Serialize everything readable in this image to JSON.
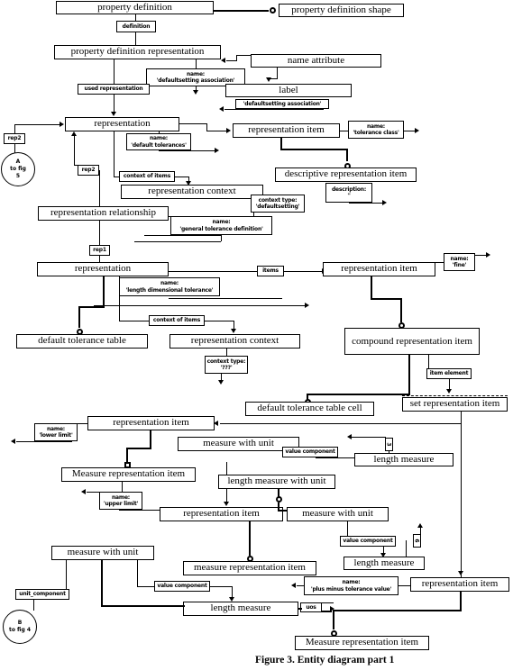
{
  "figure": {
    "caption": "Figure 3.  Entity diagram part 1"
  },
  "entities": [
    {
      "id": "property_definition",
      "label": "property definition"
    },
    {
      "id": "property_definition_shape",
      "label": "property definition shape"
    },
    {
      "id": "property_definition_representation",
      "label": "property definition representation"
    },
    {
      "id": "name_attribute",
      "label": "name attribute"
    },
    {
      "id": "label",
      "label": "label"
    },
    {
      "id": "representation_1",
      "label": "representation"
    },
    {
      "id": "representation_item_1",
      "label": "representation item"
    },
    {
      "id": "descriptive_representation_item",
      "label": "descriptive representation item"
    },
    {
      "id": "representation_context_1",
      "label": "representation context"
    },
    {
      "id": "representation_relationship",
      "label": "representation relationship"
    },
    {
      "id": "representation_2",
      "label": "representation"
    },
    {
      "id": "representation_item_2",
      "label": "representation item"
    },
    {
      "id": "default_tolerance_table",
      "label": "default tolerance table"
    },
    {
      "id": "representation_context_2",
      "label": "representation context"
    },
    {
      "id": "compound_representation_item",
      "label": "compound representation item"
    },
    {
      "id": "default_tolerance_table_cell",
      "label": "default tolerance table cell"
    },
    {
      "id": "set_representation_item",
      "label": "set representation item"
    },
    {
      "id": "representation_item_3",
      "label": "representation item"
    },
    {
      "id": "measure_with_unit_1",
      "label": "measure with unit"
    },
    {
      "id": "length_measure_1",
      "label": "length measure"
    },
    {
      "id": "measure_representation_item_1",
      "label": "Measure representation item"
    },
    {
      "id": "length_measure_with_unit",
      "label": "length measure with unit"
    },
    {
      "id": "representation_item_4",
      "label": "representation item"
    },
    {
      "id": "measure_with_unit_2",
      "label": "measure with unit"
    },
    {
      "id": "length_measure_2",
      "label": "length measure"
    },
    {
      "id": "measure_with_unit_3",
      "label": "measure with unit"
    },
    {
      "id": "measure_representation_item_2",
      "label": "measure representation item"
    },
    {
      "id": "length_measure_3",
      "label": "length measure"
    },
    {
      "id": "representation_item_5",
      "label": "representation item"
    },
    {
      "id": "measure_representation_item_3",
      "label": "Measure representation item"
    }
  ],
  "attributes": [
    {
      "id": "definition",
      "label": "definition"
    },
    {
      "id": "name_defsetting_assoc",
      "line1": "name:",
      "line2": "'defaultsetting association'"
    },
    {
      "id": "used_representation",
      "label": "used representation"
    },
    {
      "id": "defsetting_assoc_val",
      "label": "'defaultsetting association'"
    },
    {
      "id": "rep2_a",
      "label": "rep2"
    },
    {
      "id": "rep2_b",
      "label": "rep2"
    },
    {
      "id": "name_default_tolerances",
      "line1": "name:",
      "line2": "'default tolerances'"
    },
    {
      "id": "name_tolerance_class",
      "line1": "name:",
      "line2": "'tolerance class'"
    },
    {
      "id": "context_of_items_1",
      "label": "context of items"
    },
    {
      "id": "description_empty",
      "line1": "description:",
      "line2": "''"
    },
    {
      "id": "context_type_defsetting",
      "line1": "context type:",
      "line2": "'defaultsetting'"
    },
    {
      "id": "name_general_tol_def",
      "line1": "name:",
      "line2": "'general tolerance definition'"
    },
    {
      "id": "rep1",
      "label": "rep1"
    },
    {
      "id": "name_length_dim_tol",
      "line1": "name:",
      "line2": "'length dimensional tolerance'"
    },
    {
      "id": "items",
      "label": "items"
    },
    {
      "id": "name_fine",
      "line1": "name:",
      "line2": "'fine'"
    },
    {
      "id": "context_of_items_2",
      "label": "context of items"
    },
    {
      "id": "context_type_qqq",
      "line1": "context type:",
      "line2": "'???'"
    },
    {
      "id": "item_element",
      "label": "item element"
    },
    {
      "id": "name_lower_limit",
      "line1": "name:",
      "line2": "'lower limit'"
    },
    {
      "id": "value_component_1",
      "label": "value component"
    },
    {
      "id": "name_upper_limit",
      "line1": "name:",
      "line2": "'upper limit'"
    },
    {
      "id": "value_component_2",
      "label": "value component"
    },
    {
      "id": "unit_component",
      "label": "unit_component"
    },
    {
      "id": "value_component_3",
      "label": "value component"
    },
    {
      "id": "name_plus_minus",
      "line1": "name:",
      "line2": "'plus minus tolerance value'"
    },
    {
      "id": "uos",
      "label": "uos"
    }
  ],
  "numbers": [
    {
      "id": "num_3",
      "label": "3"
    },
    {
      "id": "num_6",
      "label": "6"
    }
  ],
  "page_connectors": [
    {
      "id": "conn_a",
      "line1": "A",
      "line2": "to fig",
      "line3": "5"
    },
    {
      "id": "conn_b",
      "line1": "B",
      "line2": "to fig 4"
    }
  ],
  "colors": {
    "line": "#000000",
    "background": "#ffffff",
    "text": "#000000"
  }
}
